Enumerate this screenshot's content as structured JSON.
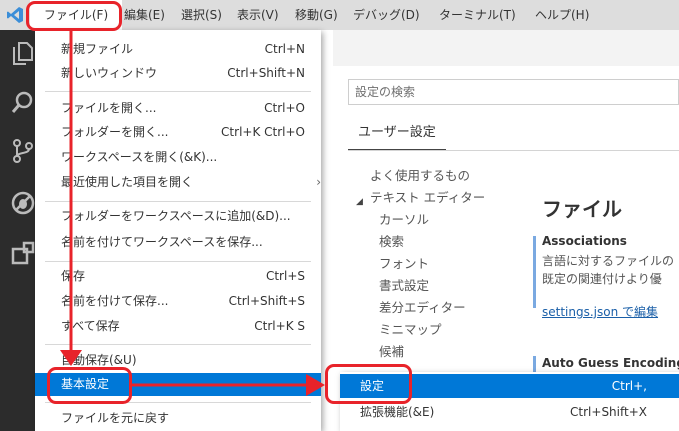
{
  "menubar": {
    "items": [
      {
        "label": "ファイル(F)",
        "active": true
      },
      {
        "label": "編集(E)"
      },
      {
        "label": "選択(S)"
      },
      {
        "label": "表示(V)"
      },
      {
        "label": "移動(G)"
      },
      {
        "label": "デバッグ(D)"
      },
      {
        "label": "ターミナル(T)"
      },
      {
        "label": "ヘルプ(H)"
      }
    ]
  },
  "activity_bar": {
    "icons": [
      "explorer-icon",
      "search-icon",
      "source-control-icon",
      "debug-icon",
      "extensions-icon"
    ]
  },
  "file_menu": {
    "items": [
      {
        "label": "新規ファイル",
        "shortcut": "Ctrl+N"
      },
      {
        "label": "新しいウィンドウ",
        "shortcut": "Ctrl+Shift+N"
      },
      {
        "label": "ファイルを開く...",
        "shortcut": "Ctrl+O"
      },
      {
        "label": "フォルダーを開く...",
        "shortcut": "Ctrl+K Ctrl+O"
      },
      {
        "label": "ワークスペースを開く(&K)...",
        "shortcut": ""
      },
      {
        "label": "最近使用した項目を開く",
        "shortcut": "",
        "submenu_arrow": "›"
      },
      {
        "label": "フォルダーをワークスペースに追加(&D)...",
        "shortcut": ""
      },
      {
        "label": "名前を付けてワークスペースを保存...",
        "shortcut": ""
      },
      {
        "label": "保存",
        "shortcut": "Ctrl+S"
      },
      {
        "label": "名前を付けて保存...",
        "shortcut": "Ctrl+Shift+S"
      },
      {
        "label": "すべて保存",
        "shortcut": "Ctrl+K S"
      },
      {
        "label": "自動保存(&U)",
        "shortcut": ""
      },
      {
        "label": "基本設定",
        "shortcut": "",
        "highlighted": true
      },
      {
        "label": "ファイルを元に戻す",
        "shortcut": ""
      }
    ]
  },
  "preferences_submenu": {
    "items": [
      {
        "label": "設定",
        "shortcut": "Ctrl+,",
        "highlighted": true
      },
      {
        "label": "拡張機能(&E)",
        "shortcut": "Ctrl+Shift+X"
      }
    ]
  },
  "settings_editor": {
    "search_placeholder": "設定の検索",
    "tab_user": "ユーザー設定",
    "toc": [
      {
        "label": "よく使用するもの"
      },
      {
        "label": "テキスト エディター",
        "expanded": true
      },
      {
        "label": "カーソル"
      },
      {
        "label": "検索"
      },
      {
        "label": "フォント"
      },
      {
        "label": "書式設定"
      },
      {
        "label": "差分エディター"
      },
      {
        "label": "ミニマップ"
      },
      {
        "label": "候補"
      }
    ],
    "section_title": "ファイル",
    "settings": [
      {
        "name": "Associations",
        "description_line1": "言語に対するファイルの",
        "description_line2": "既定の関連付けより優",
        "link": "settings.json で編集"
      },
      {
        "name": "Auto Guess Encoding"
      }
    ]
  },
  "colors": {
    "highlight": "#0078d7",
    "annotation_red": "#e8232a",
    "menubar_bg": "#dddddd",
    "activity_bar_bg": "#2c2c2c"
  }
}
